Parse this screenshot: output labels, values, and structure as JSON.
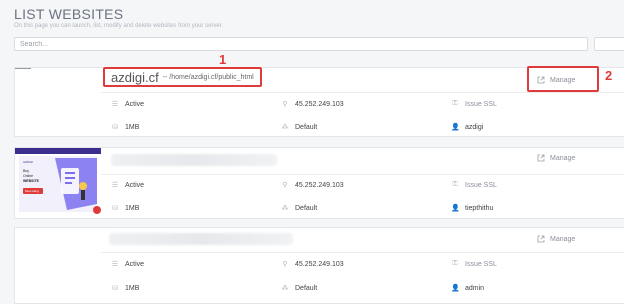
{
  "header": {
    "title": "LIST WEBSITES",
    "subtitle": "On this page you can launch, list, modify and delete websites from your server."
  },
  "search": {
    "placeholder": "Search..."
  },
  "manage_label": "Manage",
  "annotations": {
    "one": "1",
    "two": "2"
  },
  "colors": {
    "annotation": "#e03b3b",
    "muted": "#8a9099"
  },
  "websites": [
    {
      "domain": "azdigi.cf",
      "path": "-- /home/azdigi.cf/public_html",
      "status": "Active",
      "ip": "45.252.249.103",
      "ssl": "Issue SSL",
      "disk": "1MB",
      "package": "Default",
      "owner": "azdigi"
    },
    {
      "status": "Active",
      "ip": "45.252.249.103",
      "ssl": "Issue SSL",
      "disk": "1MB",
      "package": "Default",
      "owner": "tiepthithu",
      "thumbnail": {
        "brand": "AZDIGI",
        "headline_1": "Buy",
        "headline_2": "Online",
        "headline_3": "WEBSITE",
        "button": "Mua Hàng"
      }
    },
    {
      "status": "Active",
      "ip": "45.252.249.103",
      "ssl": "Issue SSL",
      "disk": "1MB",
      "package": "Default",
      "owner": "admin"
    }
  ]
}
